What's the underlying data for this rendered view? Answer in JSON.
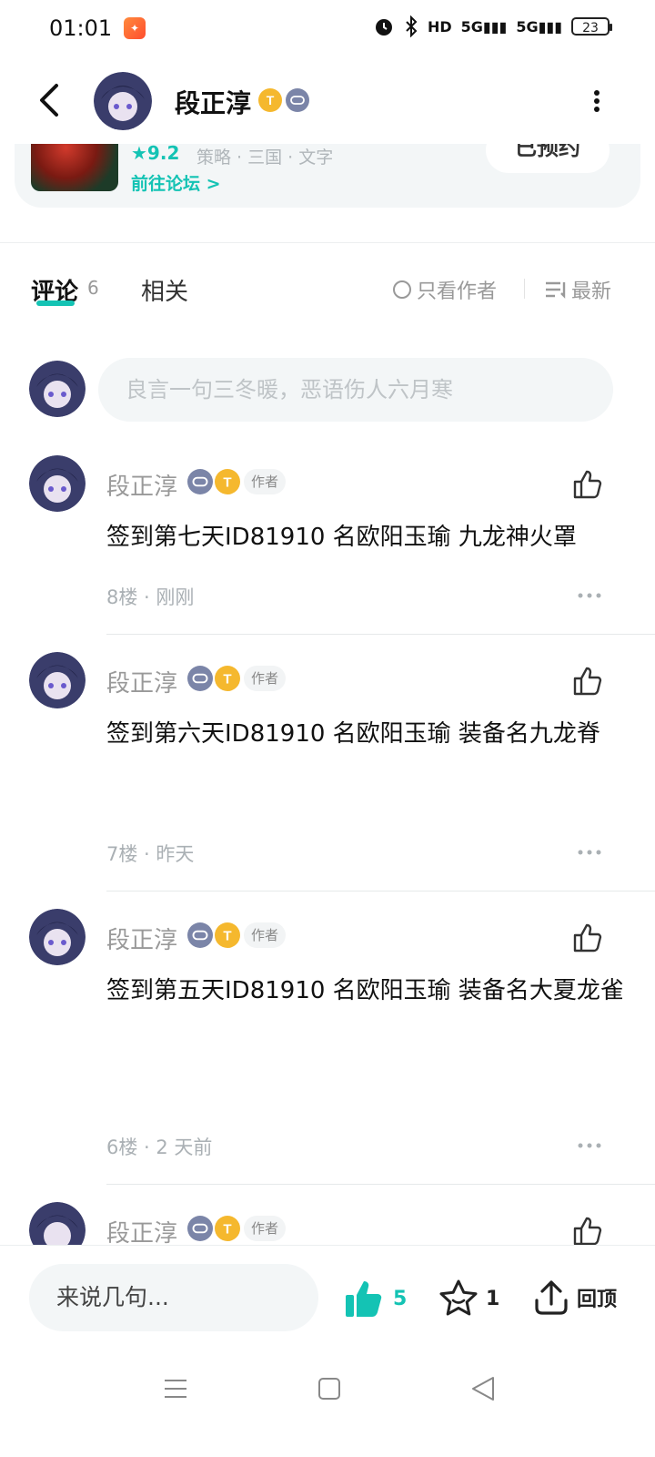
{
  "status_bar": {
    "time": "01:01",
    "battery": "23",
    "signal_1": "5G",
    "signal_2": "5G",
    "hd": "HD"
  },
  "header": {
    "user_name": "段正淳"
  },
  "game_card": {
    "rating": "★9.2",
    "tags": "策略 · 三国 · 文字",
    "forum_link": "前往论坛 >",
    "reserve_button": "已预约"
  },
  "tabs": {
    "comments_label": "评论",
    "comments_count": "6",
    "related_label": "相关",
    "author_only_label": "只看作者",
    "sort_label": "最新"
  },
  "comment_input": {
    "placeholder": "良言一句三冬暖，恶语伤人六月寒"
  },
  "comments": [
    {
      "name": "段正淳",
      "author_tag": "作者",
      "text": "签到第七天ID81910 名欧阳玉瑜 九龙神火罩",
      "meta": "8楼 · 刚刚"
    },
    {
      "name": "段正淳",
      "author_tag": "作者",
      "text": "签到第六天ID81910 名欧阳玉瑜 装备名九龙脊",
      "meta": "7楼 · 昨天"
    },
    {
      "name": "段正淳",
      "author_tag": "作者",
      "text": "签到第五天ID81910 名欧阳玉瑜 装备名大夏龙雀",
      "meta": "6楼 · 2 天前"
    },
    {
      "name": "段正淳",
      "author_tag": "作者"
    }
  ],
  "bottom_bar": {
    "input_placeholder": "来说几句...",
    "like_count": "5",
    "favorite_count": "1",
    "back_to_top": "回顶"
  },
  "colors": {
    "accent": "#14c3b4",
    "muted_text": "#999999",
    "input_bg": "#f3f6f7"
  },
  "icons": {
    "back": "chevron-left-icon",
    "more": "more-vertical-icon",
    "badge_gold": "gold-t-badge-icon",
    "badge_game": "gamepad-badge-icon",
    "like": "thumbs-up-icon",
    "favorite": "star-icon",
    "top": "upload-arrow-icon",
    "comment_more": "more-horizontal-icon"
  }
}
